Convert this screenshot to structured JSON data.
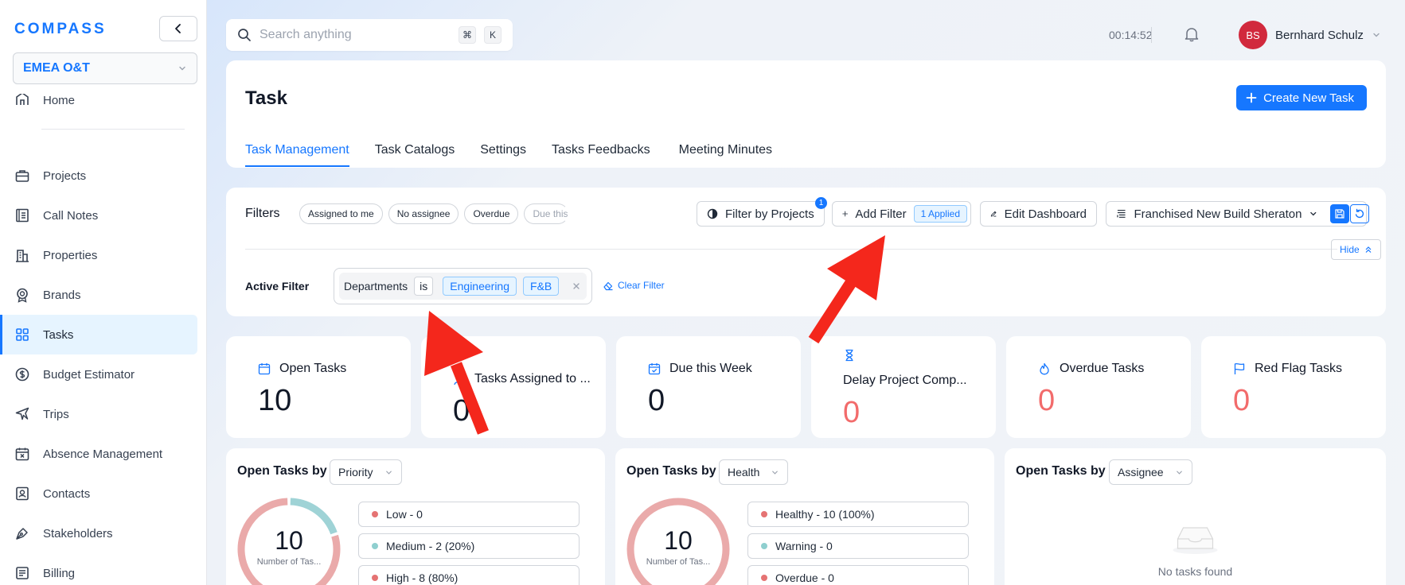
{
  "app": {
    "logo_text": "COMPASS",
    "org": "EMEA O&T"
  },
  "sidebar": {
    "home_label": "Home",
    "items": [
      {
        "label": "Projects",
        "icon": "briefcase-icon"
      },
      {
        "label": "Call Notes",
        "icon": "notebook-icon"
      },
      {
        "label": "Properties",
        "icon": "building-icon"
      },
      {
        "label": "Brands",
        "icon": "badge-icon"
      },
      {
        "label": "Tasks",
        "icon": "grid-icon",
        "active": true
      },
      {
        "label": "Budget Estimator",
        "icon": "dollar-icon"
      },
      {
        "label": "Trips",
        "icon": "plane-icon"
      },
      {
        "label": "Absence Management",
        "icon": "calendar-x-icon"
      },
      {
        "label": "Contacts",
        "icon": "contact-card-icon"
      },
      {
        "label": "Stakeholders",
        "icon": "pen-nib-icon"
      },
      {
        "label": "Billing",
        "icon": "invoice-icon"
      }
    ]
  },
  "topbar": {
    "search_placeholder": "Search anything",
    "kbd_cmd": "⌘",
    "kbd_k": "K",
    "timer": "00:14:52",
    "user_initials": "BS",
    "user_name": "Bernhard Schulz"
  },
  "page": {
    "title": "Task",
    "create_button": "Create New Task",
    "tabs": [
      "Task Management",
      "Task Catalogs",
      "Settings",
      "Tasks Feedbacks",
      "Meeting Minutes"
    ],
    "active_tab": 0
  },
  "filters": {
    "label": "Filters",
    "chips": [
      "Assigned to me",
      "No assignee",
      "Overdue",
      "Due this..."
    ],
    "filter_by_projects": "Filter by Projects",
    "filter_by_projects_count": "1",
    "add_filter": "Add Filter",
    "applied": "1 Applied",
    "edit_dashboard": "Edit Dashboard",
    "view_select": "Franchised New Build Sheraton",
    "hide": "Hide",
    "active_label": "Active Filter",
    "active_field": "Departments",
    "active_operator": "is",
    "active_values": [
      "Engineering",
      "F&B"
    ],
    "clear": "Clear Filter"
  },
  "stats": [
    {
      "label": "Open Tasks",
      "value": "10",
      "icon": "calendar-icon",
      "red": false
    },
    {
      "label": "Tasks Assigned to ...",
      "value": "0",
      "icon": "user-icon",
      "red": false
    },
    {
      "label": "Due this Week",
      "value": "0",
      "icon": "calendar-check-icon",
      "red": false
    },
    {
      "label": "Delay Project Comp...",
      "value": "0",
      "icon": "hourglass-icon",
      "red": true
    },
    {
      "label": "Overdue Tasks",
      "value": "0",
      "icon": "fire-icon",
      "red": true
    },
    {
      "label": "Red Flag Tasks",
      "value": "0",
      "icon": "flag-icon",
      "red": true
    }
  ],
  "charts": {
    "priority": {
      "title": "Open Tasks by",
      "select": "Priority",
      "center_value": "10",
      "center_label": "Number of Tas...",
      "legend": [
        {
          "label": "Low - 0",
          "color": "#e57373"
        },
        {
          "label": "Medium - 2 (20%)",
          "color": "#8fcfcf"
        },
        {
          "label": "High - 8 (80%)",
          "color": "#e57373"
        }
      ],
      "segments": [
        {
          "name": "Medium",
          "fraction": 0.2,
          "color": "#9fd3d6"
        },
        {
          "name": "High",
          "fraction": 0.8,
          "color": "#eaaaaa"
        }
      ]
    },
    "health": {
      "title": "Open Tasks by",
      "select": "Health",
      "center_value": "10",
      "center_label": "Number of Tas...",
      "legend": [
        {
          "label": "Healthy - 10 (100%)",
          "color": "#e57373"
        },
        {
          "label": "Warning - 0",
          "color": "#8fcfcf"
        },
        {
          "label": "Overdue - 0",
          "color": "#e57373"
        }
      ],
      "segments": [
        {
          "name": "Healthy",
          "fraction": 1.0,
          "color": "#eaaaaa"
        }
      ]
    },
    "assignee": {
      "title": "Open Tasks by",
      "select": "Assignee",
      "empty_text": "No tasks found"
    }
  },
  "colors": {
    "accent": "#1677ff",
    "danger": "#f26b6b",
    "annotation_arrow": "#f4271c"
  }
}
